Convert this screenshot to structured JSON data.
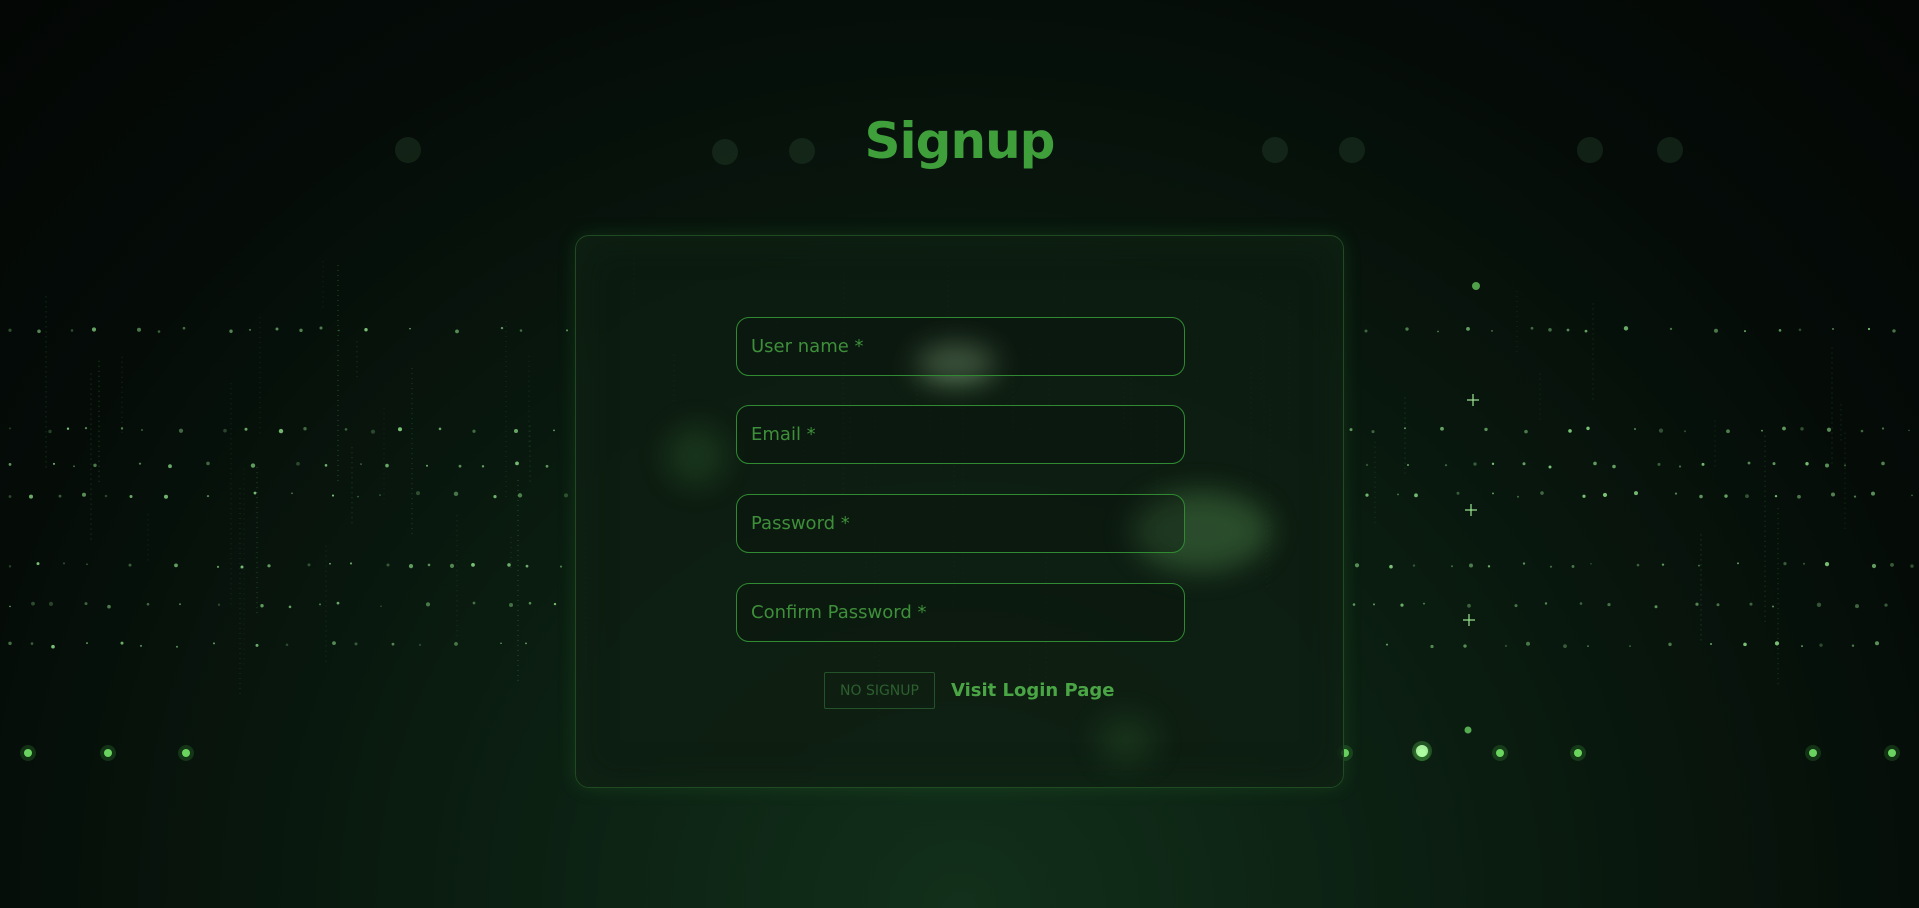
{
  "page": {
    "title": "Signup"
  },
  "form": {
    "username": {
      "placeholder": "User name *",
      "value": ""
    },
    "email": {
      "placeholder": "Email *",
      "value": ""
    },
    "password": {
      "placeholder": "Password *",
      "value": ""
    },
    "confirm_password": {
      "placeholder": "Confirm Password *",
      "value": ""
    },
    "no_signup_label": "NO SIGNUP",
    "login_link_label": "Visit Login Page"
  },
  "theme": {
    "accent": "#3f9f3a",
    "background": "#050a07",
    "field_border": "#2f8a32"
  }
}
